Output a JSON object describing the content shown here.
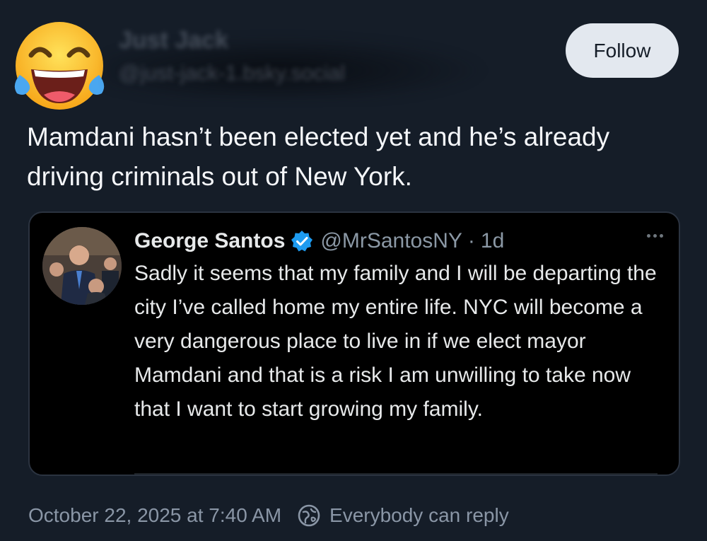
{
  "post": {
    "author_name": "Just Jack",
    "author_handle": "@just-jack-1.bsky.social",
    "avatar_icon": "joy-emoji-icon",
    "follow_label": "Follow",
    "text": "Mamdani hasn’t been elected yet and he’s already driving criminals out of New York.",
    "date": "October 22, 2025 at 7:40 AM",
    "reply_setting": "Everybody can reply",
    "reply_icon": "globe-reply-icon"
  },
  "embed": {
    "name": "George Santos",
    "verified_icon": "verified-badge-icon",
    "handle": "@MrSantosNY",
    "separator": "·",
    "time": "1d",
    "text": "Sadly it seems that my family and I will be departing the city I’ve called home my entire life. NYC will become a very dangerous place to live in if we elect mayor Mamdani and that is a risk I am unwilling to take now that I want to start growing my family.",
    "more_icon": "more-options-icon"
  },
  "colors": {
    "background": "#151d28",
    "follow_button": "#e3e8ef",
    "embed_background": "#000000",
    "verified_blue": "#1d9bf0",
    "muted_text": "#8a96a6"
  }
}
